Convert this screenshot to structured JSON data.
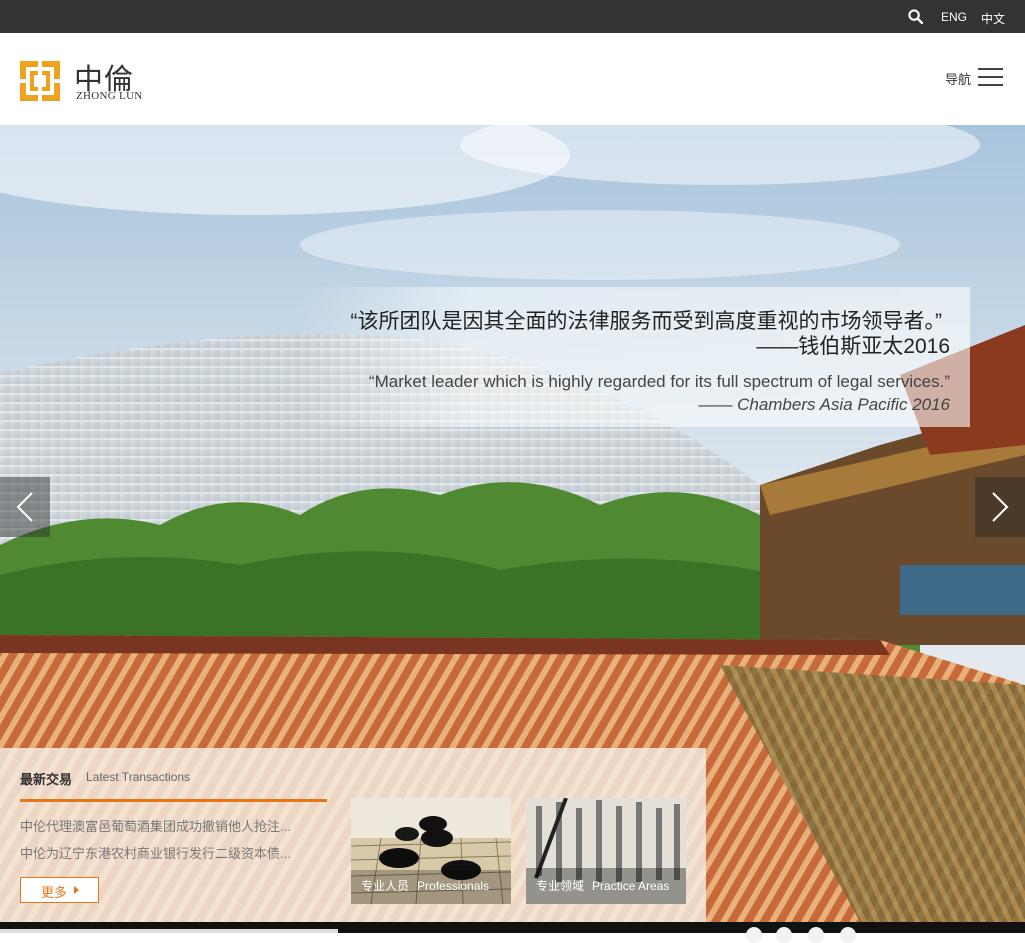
{
  "topbar": {
    "search_icon": "search-icon",
    "lang_en": "ENG",
    "lang_cn": "中文"
  },
  "header": {
    "logo_cn": "中倫",
    "logo_en": "ZHONG LUN",
    "nav_label": "导航",
    "nav_icon": "hamburger-icon"
  },
  "hero": {
    "quote_cn": "“该所团队是因其全面的法律服务而受到高度重视的市场领导者。”",
    "quote_cn_source": "——钱伯斯亚太2016",
    "quote_en": "“Market leader which is highly regarded for its full spectrum of legal services.”",
    "quote_en_source": "—— Chambers Asia Pacific 2016",
    "prev_icon": "chevron-left-icon",
    "next_icon": "chevron-right-icon"
  },
  "panel": {
    "title_cn": "最新交易",
    "title_en": "Latest Transactions",
    "news": [
      "中伦代理澳富邑葡萄酒集团成功撤销他人抢注...",
      "中伦为辽宁东港农村商业银行发行二级资本债..."
    ],
    "more_label": "更多",
    "cards": [
      {
        "label_cn": "专业人员",
        "label_en": "Professionals"
      },
      {
        "label_cn": "专业领域",
        "label_en": "Practice Areas"
      }
    ]
  },
  "colors": {
    "accent": "#e5771b",
    "topbar_bg": "#333333",
    "logo_orange": "#f0a11e"
  }
}
